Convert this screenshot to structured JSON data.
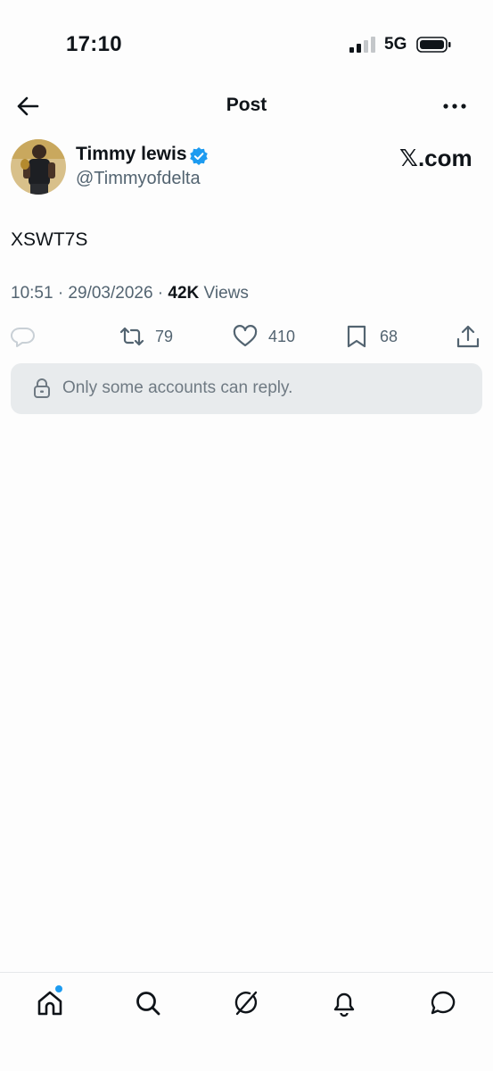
{
  "status_bar": {
    "time": "17:10",
    "network": "5G"
  },
  "nav": {
    "title": "Post"
  },
  "author": {
    "display_name": "Timmy lewis",
    "handle": "@Timmyofdelta",
    "verified": true
  },
  "brand": "𝕏.com",
  "post": {
    "text": "XSWT7S",
    "time": "10:51 · 29/03/2026 · ",
    "views_count": "42K",
    "views_label": " Views"
  },
  "actions": {
    "retweets": "79",
    "likes": "410",
    "bookmarks": "68"
  },
  "reply_restriction": "Only some accounts can reply.",
  "tabbar": {
    "items": [
      "home-icon",
      "search-icon",
      "grok-icon",
      "notifications-icon",
      "messages-icon"
    ],
    "has_notification_dot": true
  },
  "colors": {
    "accent": "#1d9bf0",
    "text": "#0f1419",
    "secondary": "#536471",
    "reply_bg": "#e8ebed"
  }
}
